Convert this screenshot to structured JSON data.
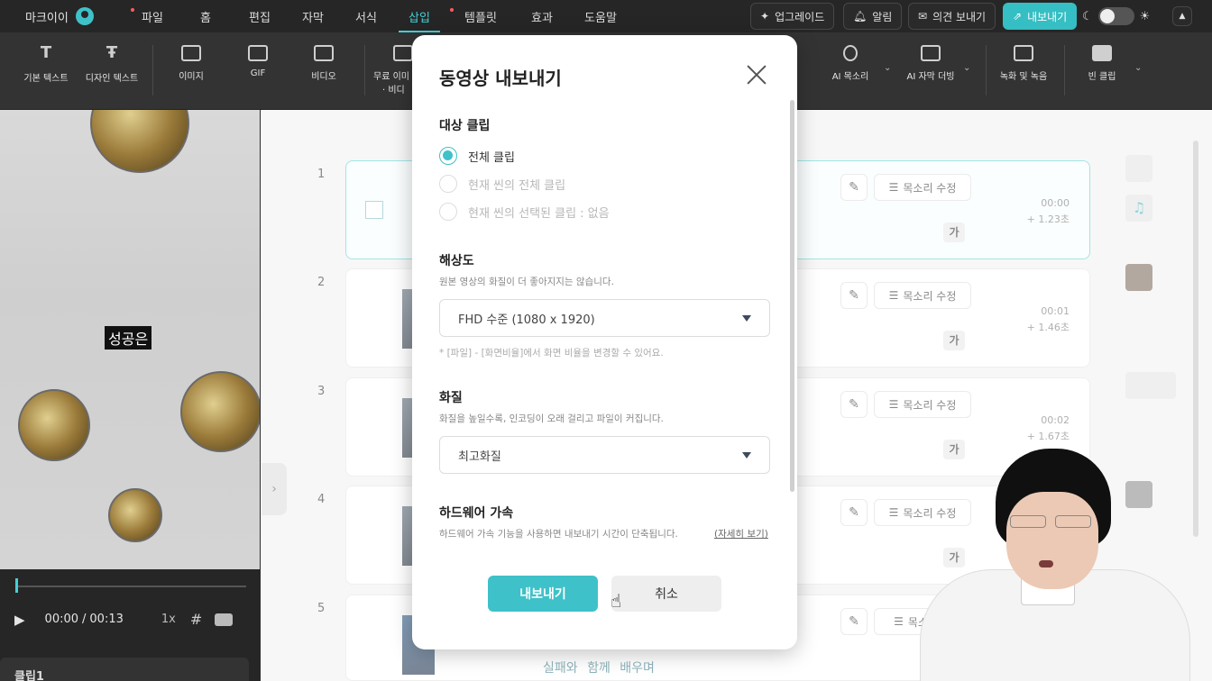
{
  "topbar": {
    "brand": "마크이이",
    "menu": [
      {
        "label": "파일",
        "dot": true
      },
      {
        "label": "홈",
        "dot": false
      },
      {
        "label": "편집",
        "dot": false
      },
      {
        "label": "자막",
        "dot": false
      },
      {
        "label": "서식",
        "dot": false
      },
      {
        "label": "삽입",
        "dot": false,
        "active": true
      },
      {
        "label": "템플릿",
        "dot": true
      },
      {
        "label": "효과",
        "dot": false
      },
      {
        "label": "도움말",
        "dot": false
      }
    ],
    "upgrade": "업그레이드",
    "alerts": "알림",
    "feedback": "의견 보내기",
    "export": "내보내기"
  },
  "toolbar": {
    "items": [
      "기본 텍스트",
      "디자인 텍스트",
      "이미지",
      "GIF",
      "비디오",
      "무료 이미",
      "· 비디",
      "AI 목소리",
      "AI 자막 더빙",
      "녹화 및 녹음",
      "빈 클립"
    ]
  },
  "preview": {
    "caption": "성공은"
  },
  "player": {
    "current": "00:00",
    "separator": "/",
    "total": "00:13",
    "speed": "1x"
  },
  "clip_tab": "클립1",
  "clips": [
    {
      "num": "1",
      "time": "00:00",
      "dur": "+ 1.23초",
      "voice": "목소리 수정",
      "ga": "가"
    },
    {
      "num": "2",
      "time": "00:01",
      "dur": "+ 1.46초",
      "voice": "목소리 수정",
      "ga": "가"
    },
    {
      "num": "3",
      "time": "00:02",
      "dur": "+ 1.67초",
      "voice": "목소리 수정",
      "ga": "가"
    },
    {
      "num": "4",
      "time": "",
      "dur": "",
      "voice": "목소리 수정",
      "ga": "가"
    },
    {
      "num": "5",
      "time": "",
      "dur": "",
      "voice": "목소리 수",
      "ga": ""
    }
  ],
  "bottom_subtitle": "실패와 함께 배우며",
  "modal": {
    "title": "동영상 내보내기",
    "target": {
      "title": "대상 클립",
      "options": [
        {
          "label": "전체 클립",
          "selected": true,
          "disabled": false
        },
        {
          "label": "현재 씬의 전체 클립",
          "selected": false,
          "disabled": true
        },
        {
          "label": "현재 씬의 선택된 클립 : 없음",
          "selected": false,
          "disabled": true
        }
      ]
    },
    "resolution": {
      "title": "해상도",
      "hint": "원본 영상의 화질이 더 좋아지지는 않습니다.",
      "value": "FHD 수준 (1080 x 1920)",
      "note": "* [파일] - [화면비율]에서 화면 비율을 변경할 수 있어요."
    },
    "quality": {
      "title": "화질",
      "hint": "화질을 높일수록, 인코딩이 오래 걸리고 파일이 커집니다.",
      "value": "최고화질"
    },
    "hw": {
      "title": "하드웨어 가속",
      "hint": "하드웨어 가속 기능을 사용하면 내보내기 시간이 단축됩니다.",
      "learn_more": "(자세히 보기)"
    },
    "export_label": "내보내기",
    "cancel_label": "취소"
  },
  "colors": {
    "accent": "#3fc1c9",
    "topbar_bg": "#262626",
    "toolbar_bg": "#333333"
  }
}
